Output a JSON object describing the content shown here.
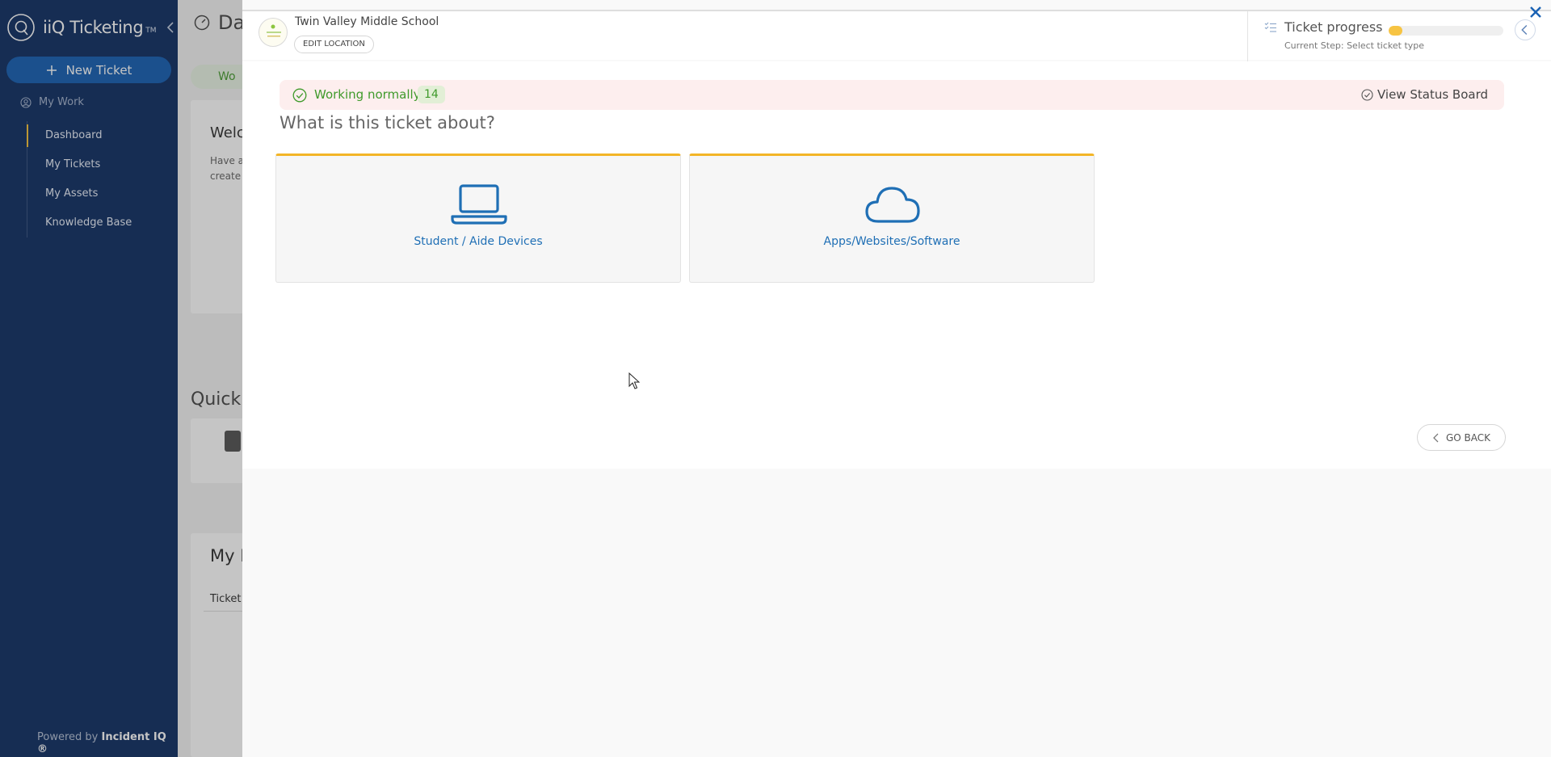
{
  "sidebar": {
    "brand_name": "iiQ Ticketing",
    "brand_tm": "TM",
    "new_ticket_label": "New Ticket",
    "section_label": "My Work",
    "items": [
      {
        "label": "Dashboard",
        "active": true
      },
      {
        "label": "My Tickets",
        "active": false
      },
      {
        "label": "My Assets",
        "active": false
      },
      {
        "label": "Knowledge Base",
        "active": false
      }
    ],
    "powered_prefix": "Powered by",
    "powered_brand": "Incident IQ ®"
  },
  "background": {
    "page_title": "Da",
    "status_badge": "Wo",
    "welcome_title": "Welc",
    "welcome_line1": "Have a",
    "welcome_line2": "create",
    "quick_title": "Quick T",
    "my_title": "My F",
    "column_header": "Ticket"
  },
  "modal": {
    "location_name": "Twin Valley Middle School",
    "edit_location_label": "EDIT LOCATION",
    "progress": {
      "title": "Ticket progress",
      "fill_fraction": 0.12,
      "step_label": "Current Step:",
      "step_value": "Select ticket type"
    },
    "status": {
      "text": "Working normally",
      "count": "14",
      "link_label": "View Status Board"
    },
    "question": "What is this ticket about?",
    "ticket_types": [
      {
        "label": "Student / Aide Devices",
        "icon": "laptop-icon"
      },
      {
        "label": "Apps/Websites/Software",
        "icon": "cloud-icon"
      }
    ],
    "go_back_label": "GO BACK"
  },
  "colors": {
    "sidebar_bg": "#133266",
    "primary_button": "#1a62b4",
    "accent_yellow": "#f3b527",
    "status_green": "#3f9a2b",
    "status_bg": "#fdeeee",
    "link_blue": "#1f6fb5"
  }
}
